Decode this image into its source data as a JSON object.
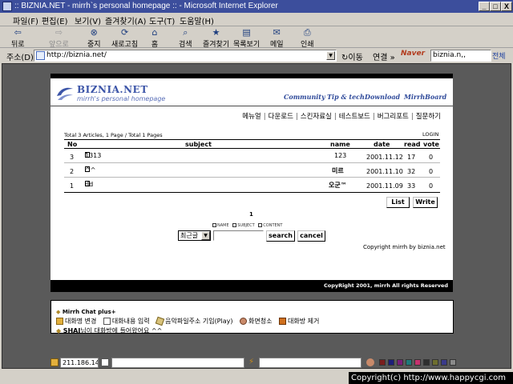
{
  "window": {
    "title": ":: BIZNIA.NET - mirrh`s personal homepage :: - Microsoft Internet Explorer",
    "min_label": "_",
    "max_label": "□",
    "close_label": "X"
  },
  "menu": [
    "파일(F)",
    "편집(E)",
    "보기(V)",
    "즐겨찾기(A)",
    "도구(T)",
    "도움말(H)"
  ],
  "toolbar": {
    "back": "뒤로",
    "forward": "앞으로",
    "stop": "중지",
    "refresh": "새로고침",
    "home": "홈",
    "search": "검색",
    "favorites": "즐겨찾기",
    "history": "목록보기",
    "mail": "메일",
    "print": "인쇄"
  },
  "address": {
    "label": "주소(D)",
    "url": "http://biznia.net/",
    "go": "이동",
    "links": "연결 »",
    "naver_logo": "Naver",
    "search_value": "biznia.n,,",
    "search_all": "전체"
  },
  "site": {
    "logo_title": "BIZNIA.NET",
    "logo_subtitle": "mirrh's personal homepage",
    "top_nav": [
      "Community",
      "Tip & tech",
      "Download",
      "MirrhBoard"
    ],
    "kor_links": [
      "메뉴얼",
      "다운로드",
      "스킨자료실",
      "테스트보드",
      "버그리포트",
      "질문하기"
    ],
    "separator": "|"
  },
  "board": {
    "total_text": "Total 3 Articles, 1 Page / Total 1 Pages",
    "login": "LOGIN",
    "columns": {
      "no": "No",
      "subject": "subject",
      "name": "name",
      "date": "date",
      "read": "read",
      "vote": "vote"
    },
    "rows": [
      {
        "no": "3",
        "subject": "1313",
        "name": "123",
        "date": "2001.11.12",
        "read": "17",
        "vote": "0"
      },
      {
        "no": "2",
        "subject": "^^",
        "name": "미르",
        "date": "2001.11.10",
        "read": "32",
        "vote": "0"
      },
      {
        "no": "1",
        "subject": "dd",
        "name": "오군™",
        "date": "2001.11.09",
        "read": "33",
        "vote": "0"
      }
    ],
    "list_button": "List",
    "write_button": "Write",
    "page_number": "1",
    "radio_options": [
      "NAME",
      "SUBJECT",
      "CONTENT"
    ],
    "select_value": "최근글",
    "search_button": "search",
    "cancel_button": "cancel",
    "copyright_site": "Copyright mirrh by biznia.net",
    "footer": "CopyRight 2001, mirrh All rights Reserved"
  },
  "chat": {
    "title": "Mirrh Chat plus+",
    "actions": [
      "대화명 변경",
      "대화내용 입력",
      "음악파일주소 기입(Play)",
      "화면청소",
      "대화방 제거"
    ],
    "message_user": "SHAI",
    "message_text": "님이 대화방에 들어왔어요 ^^"
  },
  "statusbar": {
    "ip": "211.186.146."
  },
  "watermark": "Copyright(c) http://www.happycgi.com",
  "colors": {
    "titlebar": "#3c4e9c",
    "logo_blue": "#3c55a8",
    "chrome": "#d4d0c8",
    "content_gray": "#5a5a5a"
  }
}
